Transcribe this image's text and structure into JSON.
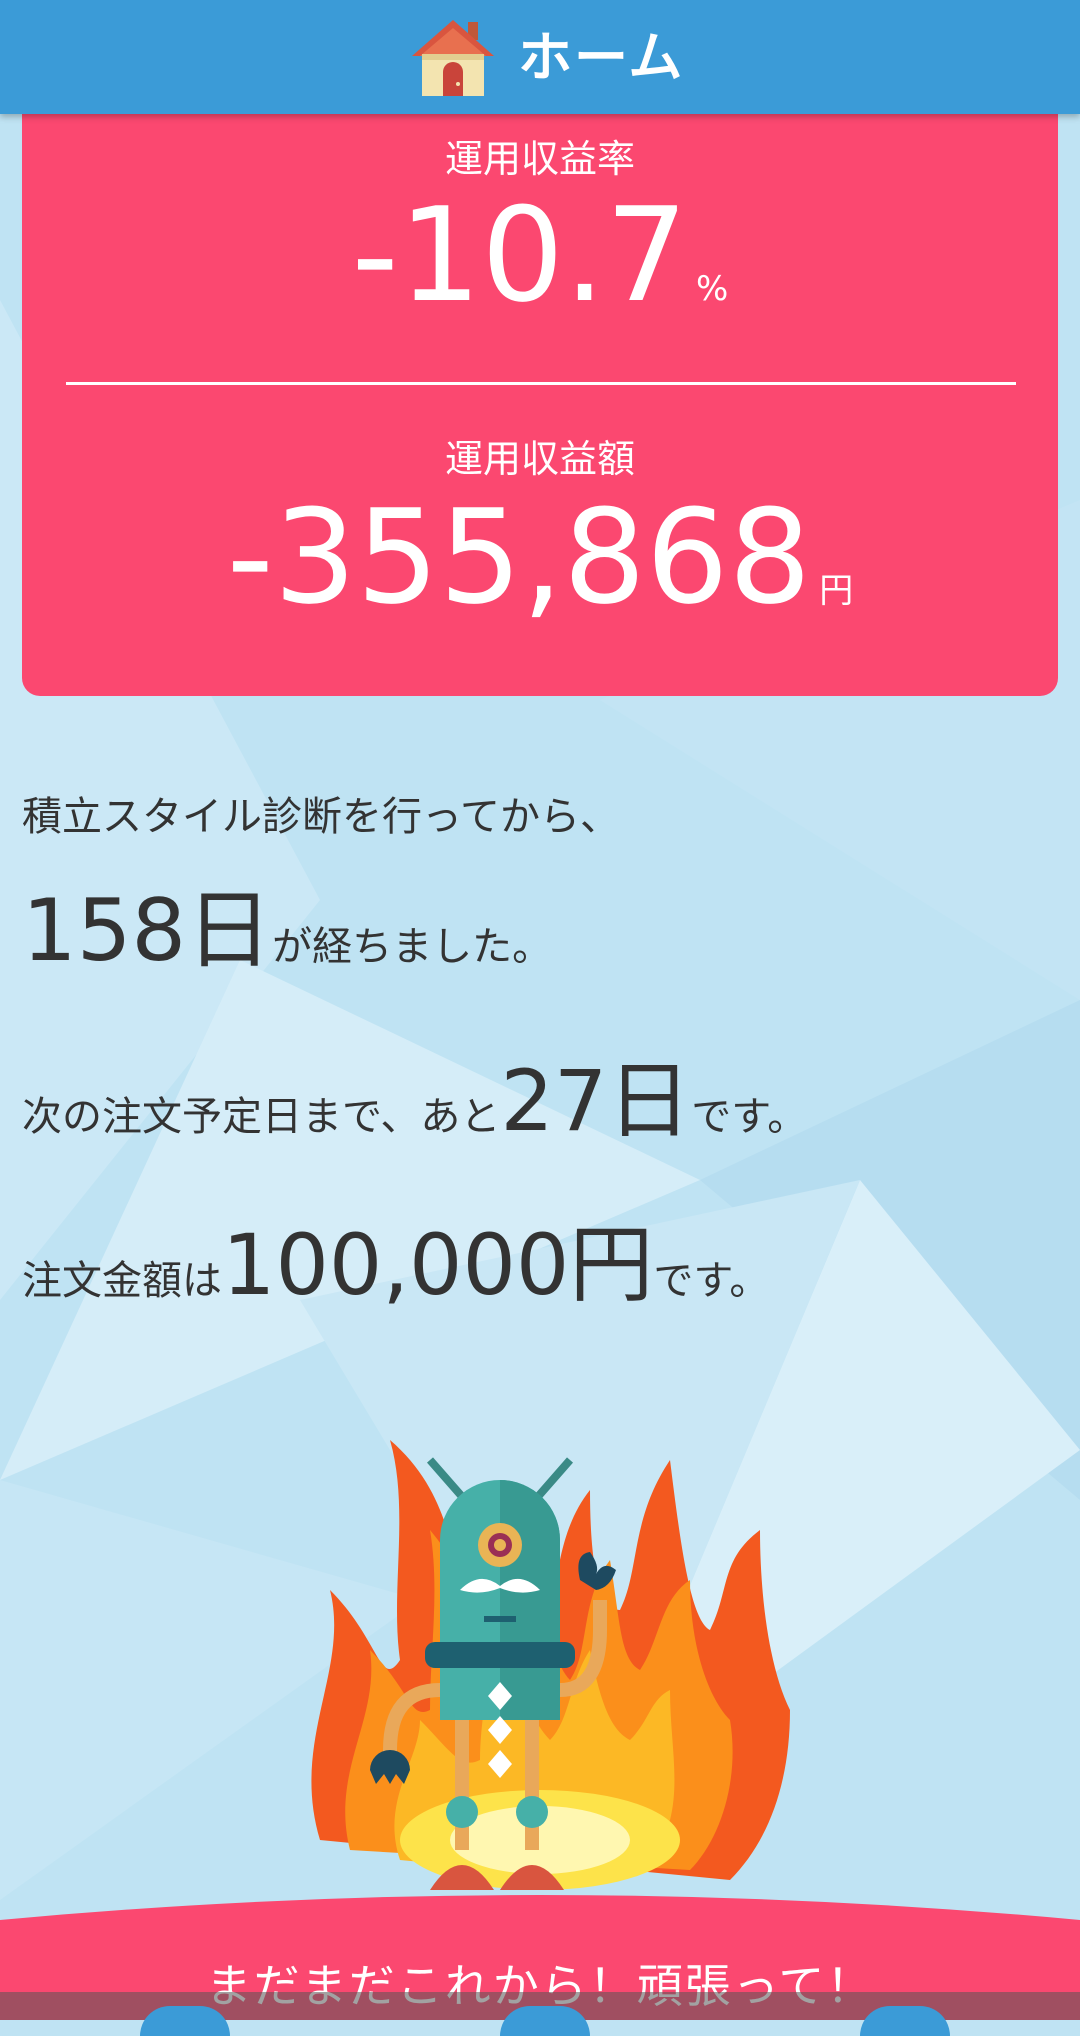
{
  "header": {
    "title": "ホーム",
    "icon": "home-icon"
  },
  "card": {
    "rate_label": "運用収益率",
    "rate_value": "-10.7",
    "rate_unit": "%",
    "amount_label": "運用収益額",
    "amount_value": "-355,868",
    "amount_unit": "円"
  },
  "info": {
    "line1": "積立スタイル診断を行ってから、",
    "days_elapsed": "158日",
    "days_elapsed_suffix": "が経ちました。",
    "next_prefix": "次の注文予定日まで、あと",
    "next_days": "27日",
    "next_suffix": "です。",
    "order_prefix": "注文金額は",
    "order_amount": "100,000円",
    "order_suffix": "です。"
  },
  "banner": {
    "message": "まだまだこれから！頑張って！"
  },
  "colors": {
    "header": "#3b9bd7",
    "card": "#fb4870",
    "background": "#bfe3f3"
  }
}
